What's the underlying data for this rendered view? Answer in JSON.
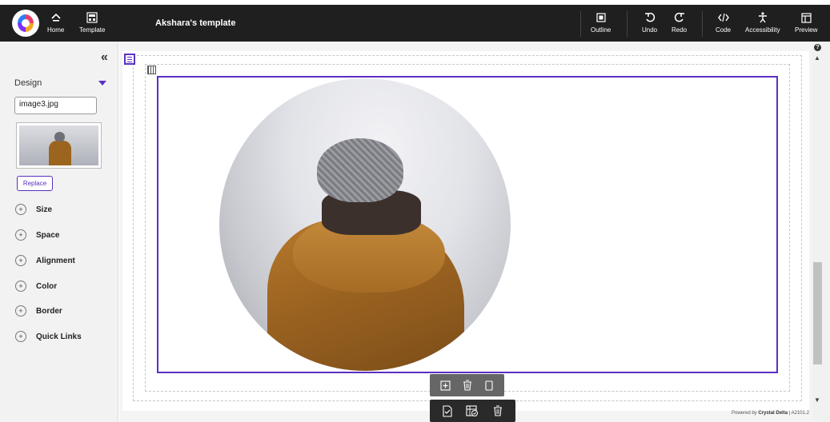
{
  "topbar": {
    "title": "Akshara's template",
    "home_label": "Home",
    "template_label": "Template",
    "outline_label": "Outline",
    "undo_label": "Undo",
    "redo_label": "Redo",
    "code_label": "Code",
    "accessibility_label": "Accessibility",
    "preview_label": "Preview"
  },
  "sidebar": {
    "collapse_glyph": "«",
    "section_label": "Design",
    "image_name": "image3.jpg",
    "replace_label": "Replace",
    "accordion": [
      {
        "label": "Size"
      },
      {
        "label": "Space"
      },
      {
        "label": "Alignment"
      },
      {
        "label": "Color"
      },
      {
        "label": "Border"
      },
      {
        "label": "Quick Links"
      }
    ]
  },
  "footer": {
    "powered_by": "Powered by",
    "brand": "Crystal Delta",
    "separator": "|",
    "version": "A2101.2"
  },
  "colors": {
    "accent": "#5a2fc2",
    "topbar_bg": "#1f1f1f"
  }
}
